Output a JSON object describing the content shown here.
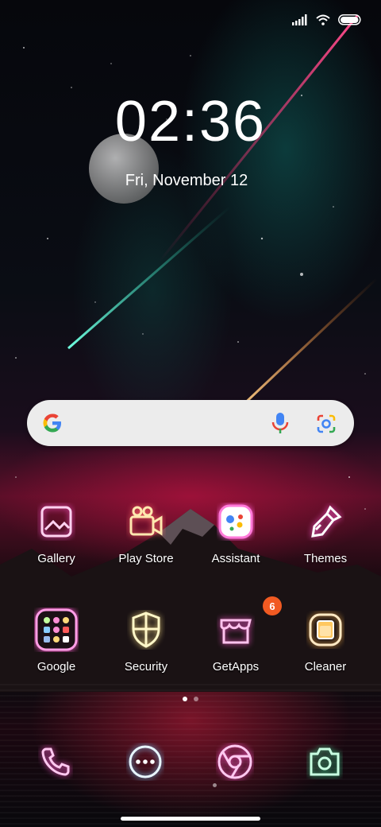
{
  "status_bar": {
    "signal": "signal-icon",
    "wifi": "wifi-icon",
    "battery": "battery-icon"
  },
  "lockclock": {
    "time": "02:36",
    "date": "Fri, November 12"
  },
  "search": {
    "logo": "google-g-icon",
    "mic": "mic-icon",
    "lens": "google-lens-icon"
  },
  "apps_row1": [
    {
      "label": "Gallery",
      "icon": "gallery-icon"
    },
    {
      "label": "Play Store",
      "icon": "play-store-icon"
    },
    {
      "label": "Assistant",
      "icon": "assistant-icon"
    },
    {
      "label": "Themes",
      "icon": "themes-brush-icon"
    }
  ],
  "apps_row2": [
    {
      "label": "Google",
      "icon": "google-folder-icon"
    },
    {
      "label": "Security",
      "icon": "shield-icon"
    },
    {
      "label": "GetApps",
      "icon": "store-icon",
      "badge": "6"
    },
    {
      "label": "Cleaner",
      "icon": "cleaner-icon"
    }
  ],
  "dock": [
    {
      "icon": "phone-icon"
    },
    {
      "icon": "messages-icon"
    },
    {
      "icon": "chrome-icon"
    },
    {
      "icon": "camera-icon"
    }
  ],
  "pager": {
    "pages": 2,
    "current": 1
  },
  "colors": {
    "neon_pink": "#ff7ad9",
    "neon_yellow": "#ffe58a",
    "neon_green": "#7dffb8",
    "badge": "#f15a22"
  }
}
